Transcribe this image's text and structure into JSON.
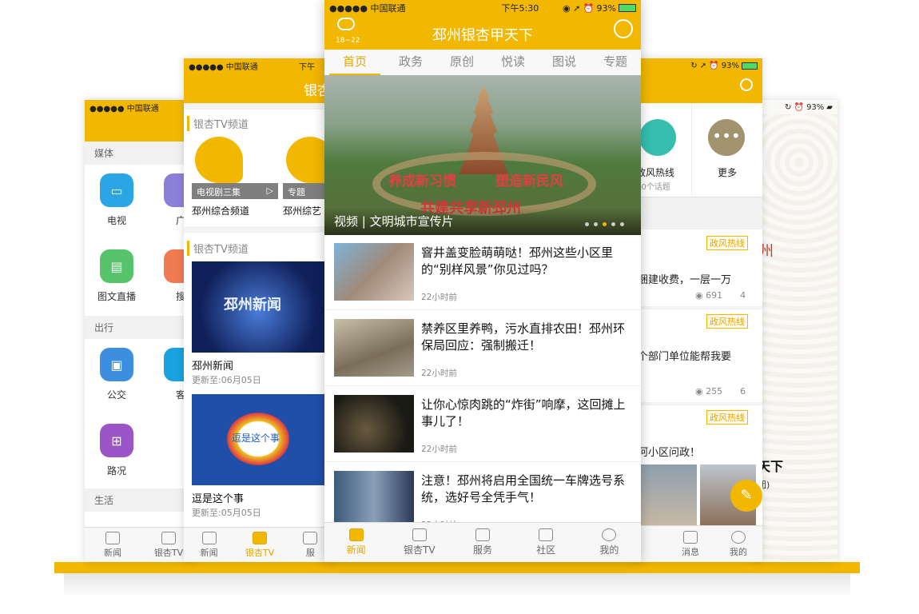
{
  "phone1": {
    "carrier": "●●●●● 中国联通",
    "sec_media": "媒体",
    "sec_travel": "出行",
    "sec_life": "生活",
    "services": [
      {
        "label": "电视",
        "icon": "tv-icon",
        "color": "#2aa6e6"
      },
      {
        "label": "广",
        "icon": "radio-icon",
        "color": "#8c7fd8"
      },
      {
        "label": "图文直播",
        "icon": "live-icon",
        "color": "#55c46b"
      },
      {
        "label": "搜",
        "icon": "search-icon",
        "color": "#f07b52"
      },
      {
        "label": "公交",
        "icon": "bus-icon",
        "color": "#3c8fe0"
      },
      {
        "label": "客",
        "icon": "coach-icon",
        "color": "#1aa2e0"
      },
      {
        "label": "路况",
        "icon": "road-icon",
        "color": "#9b55c6"
      }
    ],
    "tabs": [
      "新闻",
      "银杏TV"
    ]
  },
  "phone2": {
    "carrier": "●●●●● 中国联通",
    "time": "下午",
    "title": "银杏",
    "section1": "银杏TV频道",
    "section2": "银杏TV频道",
    "channels": [
      {
        "overlay": "电视剧三集",
        "label": "邳州综合频道"
      },
      {
        "overlay": "专题",
        "label": "邳州综艺"
      }
    ],
    "shows": [
      {
        "title": "邳州新闻",
        "updated": "更新至:06月05日",
        "art": "邳州新闻"
      },
      {
        "title": "逗是这个事",
        "updated": "更新至:05月05日",
        "art": "逗是这个事"
      }
    ],
    "tabs": [
      "新闻",
      "银杏TV",
      "服"
    ]
  },
  "phone3": {
    "carrier": "●●●●● 中国联通",
    "time": "下午5:30",
    "battery": "93%",
    "weather": "18~22",
    "title": "邳州银杏甲天下",
    "nav": [
      "首页",
      "政务",
      "原创",
      "悦读",
      "图说",
      "专题"
    ],
    "banner": {
      "caption": "视频 | 文明城市宣传片",
      "slogan1": "养成新习惯",
      "slogan2": "塑造新民风",
      "slogan3": "共建共享新邳州"
    },
    "news": [
      {
        "title": "窨井盖变脸萌萌哒！邳州这些小区里的“别样风景”你见过吗？",
        "time": "22小时前"
      },
      {
        "title": "禁养区里养鸭，污水直排农田！邳州环保局回应：强制搬迁！",
        "time": "22小时前"
      },
      {
        "title": "让你心惊肉跳的“炸街”响摩，这回摊上事儿了！",
        "time": "22小时前"
      },
      {
        "title": "注意！邳州将启用全国统一车牌选号系统，选好号全凭手气！",
        "time": "22小时前"
      }
    ],
    "tabs": [
      "新闻",
      "银杏TV",
      "服务",
      "社区",
      "我的"
    ]
  },
  "phone4": {
    "battery": "93%",
    "cells": [
      {
        "label": "政风热线",
        "sub": "60个话题"
      },
      {
        "label": "更多"
      }
    ],
    "posts": [
      {
        "tag": "政风热线",
        "text": "捆建收费，一层一万",
        "views": "691",
        "comments": "4"
      },
      {
        "tag": "政风热线",
        "text": "个部门单位能帮我要",
        "views": "255",
        "comments": "6"
      },
      {
        "tag": "政风热线",
        "text": "河小区问政！"
      }
    ],
    "tabs": [
      "消息",
      "我的"
    ]
  },
  "phone5": {
    "battery": "93%",
    "red": "州",
    "black1": "天下",
    "black2": "团)"
  }
}
